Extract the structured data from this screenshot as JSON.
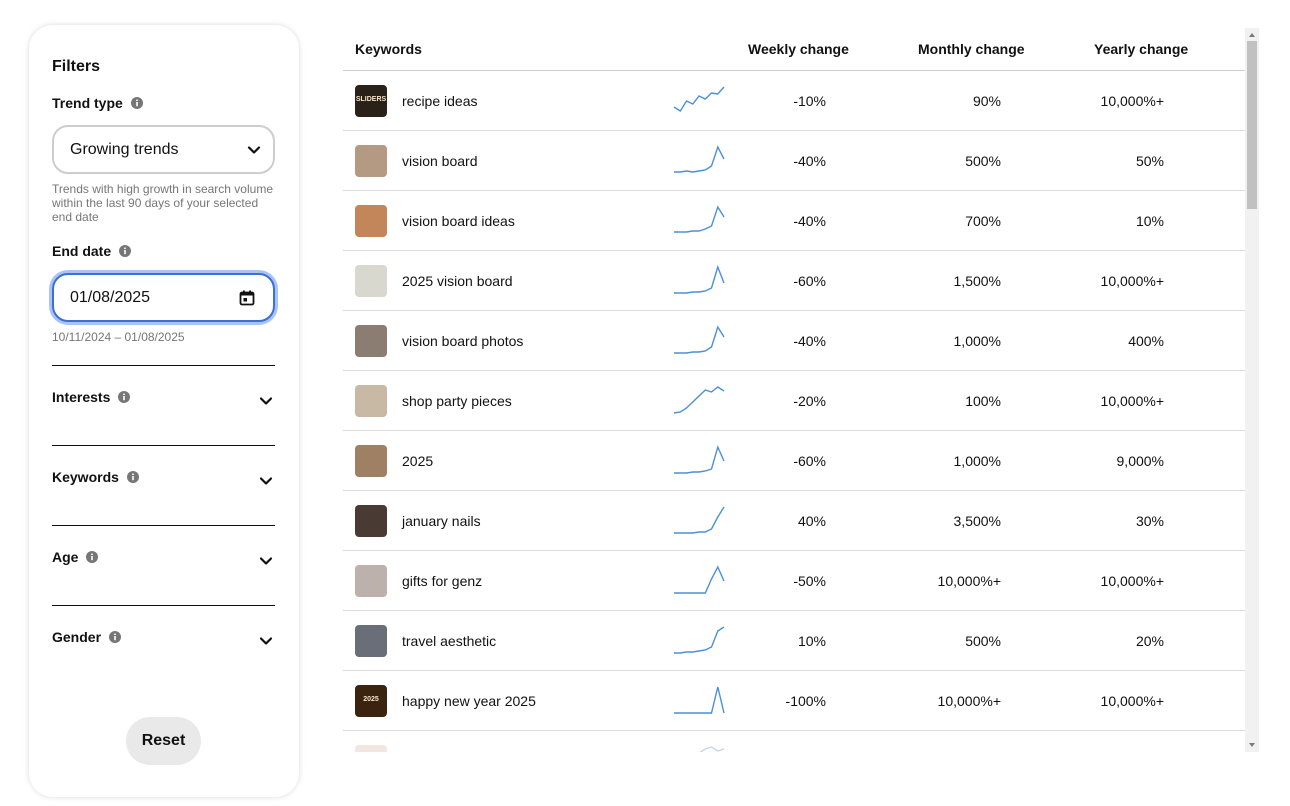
{
  "filters": {
    "title": "Filters",
    "trend_type": {
      "label": "Trend type",
      "selected": "Growing trends",
      "helper": "Trends with high growth in search volume within the last 90 days of your selected end date"
    },
    "end_date": {
      "label": "End date",
      "value": "01/08/2025",
      "range": "10/11/2024 – 01/08/2025"
    },
    "sections": [
      {
        "label": "Interests"
      },
      {
        "label": "Keywords"
      },
      {
        "label": "Age"
      },
      {
        "label": "Gender"
      }
    ],
    "reset_label": "Reset"
  },
  "table": {
    "headers": {
      "keywords": "Keywords",
      "weekly": "Weekly change",
      "monthly": "Monthly change",
      "yearly": "Yearly change"
    },
    "rows": [
      {
        "keyword": "recipe ideas",
        "weekly": "-10%",
        "monthly": "90%",
        "yearly": "10,000%+",
        "thumb": "recipe-ideas-thumbnail",
        "thumb_text": "SLIDERS",
        "thumb_color": "#2a2218",
        "spark": [
          22,
          26,
          16,
          19,
          11,
          14,
          8,
          9,
          2
        ]
      },
      {
        "keyword": "vision board",
        "weekly": "-40%",
        "monthly": "500%",
        "yearly": "50%",
        "thumb": "vision-board-thumbnail",
        "thumb_color": "#b49a82",
        "spark": [
          27,
          27,
          26,
          27,
          26,
          25,
          21,
          2,
          14
        ]
      },
      {
        "keyword": "vision board ideas",
        "weekly": "-40%",
        "monthly": "700%",
        "yearly": "10%",
        "thumb": "vision-board-ideas-thumbnail",
        "thumb_color": "#c3855a",
        "spark": [
          27,
          27,
          27,
          26,
          26,
          24,
          21,
          2,
          12
        ]
      },
      {
        "keyword": "2025 vision board",
        "weekly": "-60%",
        "monthly": "1,500%",
        "yearly": "10,000%+",
        "thumb": "2025-vision-board-thumbnail",
        "thumb_color": "#d8d8cf",
        "spark": [
          28,
          28,
          28,
          27,
          27,
          26,
          23,
          2,
          18
        ]
      },
      {
        "keyword": "vision board photos",
        "weekly": "-40%",
        "monthly": "1,000%",
        "yearly": "400%",
        "thumb": "vision-board-photos-thumbnail",
        "thumb_color": "#8c7d73",
        "spark": [
          28,
          28,
          28,
          27,
          27,
          26,
          22,
          2,
          12
        ]
      },
      {
        "keyword": "shop party pieces",
        "weekly": "-20%",
        "monthly": "100%",
        "yearly": "10,000%+",
        "thumb": "shop-party-pieces-thumbnail",
        "thumb_color": "#c8b9a5",
        "spark": [
          28,
          27,
          23,
          17,
          11,
          5,
          7,
          2,
          6
        ]
      },
      {
        "keyword": "2025",
        "weekly": "-60%",
        "monthly": "1,000%",
        "yearly": "9,000%",
        "thumb": "2025-thumbnail",
        "thumb_color": "#a08065",
        "spark": [
          28,
          28,
          28,
          27,
          27,
          26,
          24,
          2,
          16
        ]
      },
      {
        "keyword": "january nails",
        "weekly": "40%",
        "monthly": "3,500%",
        "yearly": "30%",
        "thumb": "january-nails-thumbnail",
        "thumb_color": "#4a3a34",
        "spark": [
          28,
          28,
          28,
          28,
          27,
          27,
          24,
          12,
          2
        ]
      },
      {
        "keyword": "gifts for genz",
        "weekly": "-50%",
        "monthly": "10,000%+",
        "yearly": "10,000%+",
        "thumb": "gifts-for-genz-thumbnail",
        "thumb_color": "#bcb2ab",
        "spark": [
          28,
          28,
          28,
          28,
          28,
          28,
          14,
          2,
          16
        ]
      },
      {
        "keyword": "travel aesthetic",
        "weekly": "10%",
        "monthly": "500%",
        "yearly": "20%",
        "thumb": "travel-aesthetic-thumbnail",
        "thumb_color": "#6a6e78",
        "spark": [
          28,
          28,
          27,
          27,
          26,
          25,
          22,
          6,
          2
        ]
      },
      {
        "keyword": "happy new year 2025",
        "weekly": "-100%",
        "monthly": "10,000%+",
        "yearly": "10,000%+",
        "thumb": "happy-new-year-2025-thumbnail",
        "thumb_text": "2025",
        "thumb_color": "#3a2410",
        "spark": [
          28,
          28,
          28,
          28,
          28,
          28,
          28,
          2,
          28
        ]
      },
      {
        "keyword": "",
        "weekly": "",
        "monthly": "",
        "yearly": "",
        "thumb": "partial-row-thumbnail",
        "thumb_color": "#d9b7ad",
        "spark": [
          18,
          16,
          10,
          14,
          8,
          4,
          2,
          6,
          4
        ]
      }
    ]
  },
  "icons": {
    "info": "info-icon",
    "chevron": "chevron-down-icon",
    "calendar": "calendar-icon"
  },
  "colors": {
    "sparkline": "#4a90d9",
    "focus_ring": "#3b6fd6",
    "muted_text": "#767676",
    "reset_bg": "#e9e9e9"
  }
}
